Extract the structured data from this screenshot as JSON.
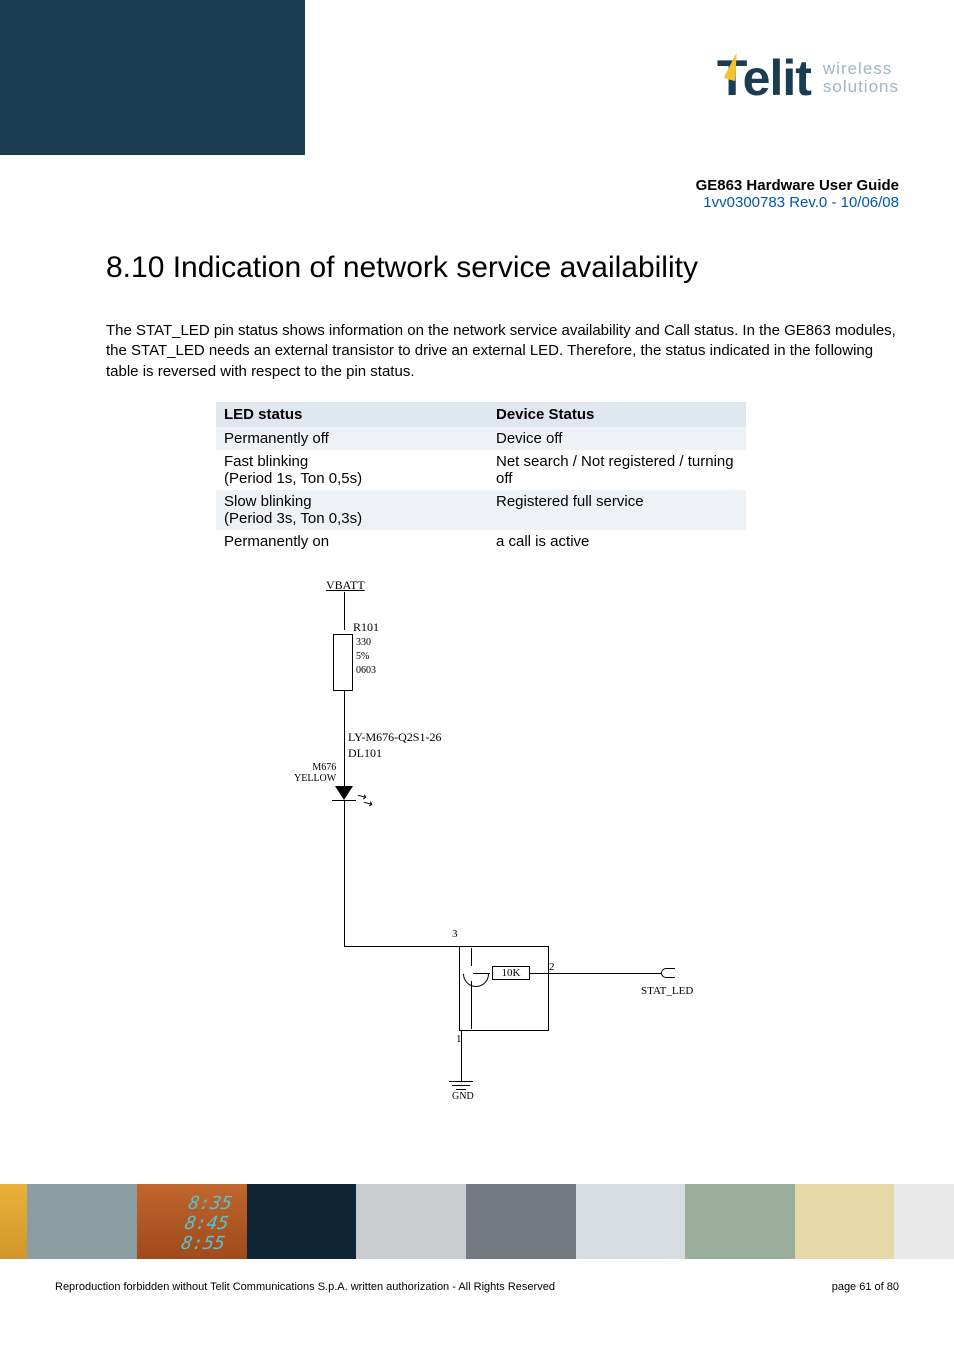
{
  "doc": {
    "title": "GE863 Hardware User Guide",
    "revision": "1vv0300783 Rev.0 - 10/06/08"
  },
  "logo": {
    "brand": "Telit",
    "tagline_line1": "wireless",
    "tagline_line2": "solutions"
  },
  "section": {
    "heading": "8.10 Indication of network service availability",
    "paragraph": "The STAT_LED pin status shows information on the network service availability and Call status. In the GE863 modules, the STAT_LED needs an external transistor to drive an external LED. Therefore, the status indicated in the following table is reversed with respect to the pin status."
  },
  "table": {
    "head_led": "LED status",
    "head_device": "Device Status",
    "rows": [
      {
        "led": "Permanently off",
        "dev": "Device off"
      },
      {
        "led": "Fast blinking\n(Period 1s, Ton 0,5s)",
        "dev": "Net search / Not registered / turning off"
      },
      {
        "led": "Slow blinking\n(Period 3s, Ton 0,3s)",
        "dev": "Registered full service"
      },
      {
        "led": "Permanently on",
        "dev": "a call is active"
      }
    ]
  },
  "schematic": {
    "vbatt": "VBATT",
    "r101": "R101",
    "r101_val": "330",
    "r101_tol": "5%",
    "r101_pkg": "0603",
    "part": "LY-M676-Q2S1-26",
    "dl101": "DL101",
    "m676": "M676",
    "yellow": "YELLOW",
    "r10k": "10K",
    "stat_led": "STAT_LED",
    "gnd": "GND",
    "pin1": "1",
    "pin2": "2",
    "pin3": "3"
  },
  "footer": {
    "copyright": "Reproduction forbidden without Telit Communications S.p.A. written authorization - All Rights Reserved",
    "page": "page 61 of 80",
    "times": [
      "8:35",
      "8:45",
      "8:55"
    ]
  }
}
